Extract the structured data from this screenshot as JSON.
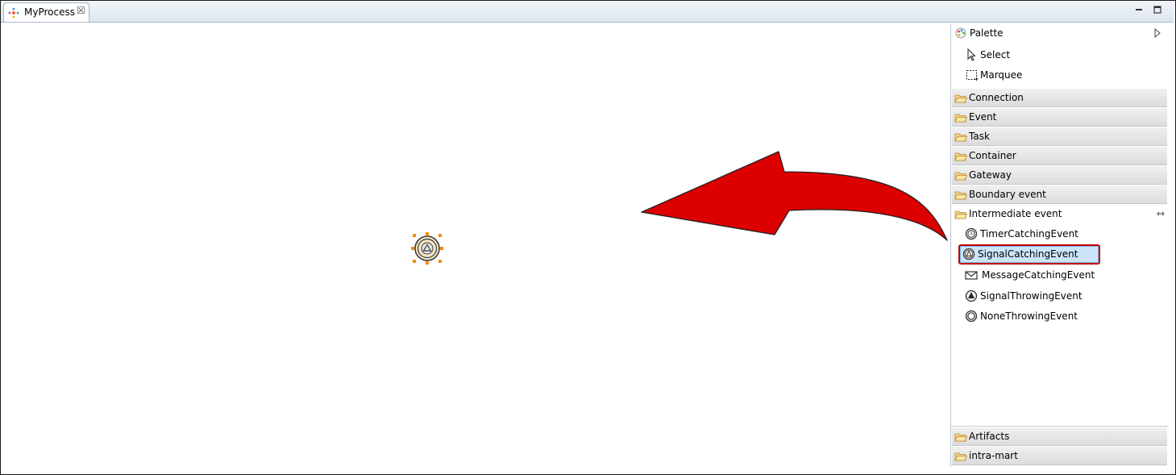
{
  "editor": {
    "tab_title": "MyProcess",
    "tab_icon": "process-diagram-icon",
    "close_icon": "close-icon"
  },
  "canvas": {
    "selected_node_icon": "signal-catching-event-icon",
    "overlay": "red-curved-arrow",
    "overlay_color": "#dd0000"
  },
  "palette": {
    "title": "Palette",
    "tools": [
      {
        "label": "Select",
        "icon": "arrow-pointer-icon"
      },
      {
        "label": "Marquee",
        "icon": "marquee-icon"
      }
    ],
    "drawers": [
      {
        "label": "Connection",
        "open": false
      },
      {
        "label": "Event",
        "open": false
      },
      {
        "label": "Task",
        "open": false
      },
      {
        "label": "Container",
        "open": false
      },
      {
        "label": "Gateway",
        "open": false
      },
      {
        "label": "Boundary event",
        "open": false
      },
      {
        "label": "Intermediate event",
        "open": true
      }
    ],
    "intermediate_items": [
      {
        "label": "TimerCatchingEvent",
        "icon": "timer-event-icon"
      },
      {
        "label": "SignalCatchingEvent",
        "icon": "signal-catching-icon",
        "selected": true
      },
      {
        "label": "MessageCatchingEvent",
        "icon": "envelope-icon"
      },
      {
        "label": "SignalThrowingEvent",
        "icon": "signal-throwing-icon"
      },
      {
        "label": "NoneThrowingEvent",
        "icon": "none-throwing-icon"
      }
    ],
    "bottom_drawers": [
      {
        "label": "Artifacts"
      },
      {
        "label": "intra-mart"
      }
    ],
    "highlight_color": "#c40000"
  }
}
